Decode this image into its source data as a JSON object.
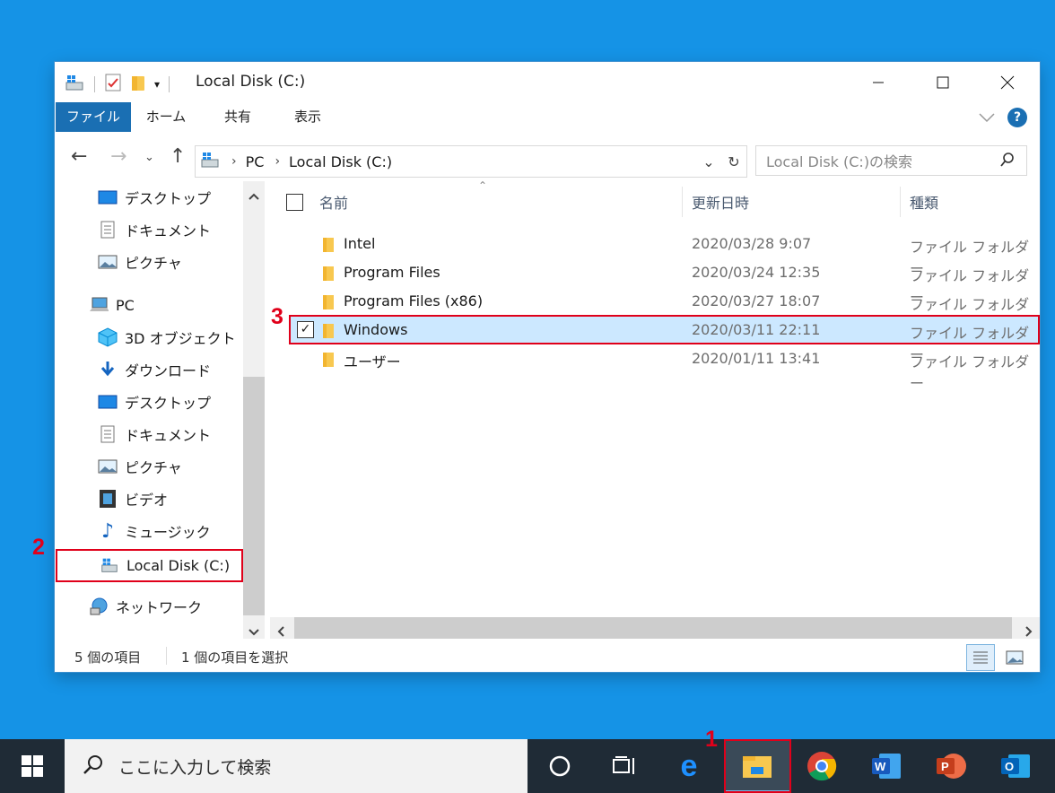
{
  "window": {
    "title": "Local Disk (C:)",
    "tabs": [
      "ファイル",
      "ホーム",
      "共有",
      "表示"
    ],
    "help": "?"
  },
  "nav": {
    "breadcrumb": [
      "PC",
      "Local Disk (C:)"
    ],
    "search_placeholder": "Local Disk (C:)の検索"
  },
  "sidebar": {
    "items": [
      {
        "label": "デスクトップ",
        "icon": "desktop-icon"
      },
      {
        "label": "ドキュメント",
        "icon": "document-icon"
      },
      {
        "label": "ピクチャ",
        "icon": "picture-icon"
      },
      {
        "label": "PC",
        "icon": "pc-icon"
      },
      {
        "label": "3D オブジェクト",
        "icon": "3d-objects-icon"
      },
      {
        "label": "ダウンロード",
        "icon": "download-icon"
      },
      {
        "label": "デスクトップ",
        "icon": "desktop-icon"
      },
      {
        "label": "ドキュメント",
        "icon": "document-icon"
      },
      {
        "label": "ピクチャ",
        "icon": "picture-icon"
      },
      {
        "label": "ビデオ",
        "icon": "video-icon"
      },
      {
        "label": "ミュージック",
        "icon": "music-icon"
      },
      {
        "label": "Local Disk (C:)",
        "icon": "local-disk-icon"
      },
      {
        "label": "ネットワーク",
        "icon": "network-icon"
      }
    ]
  },
  "columns": {
    "name": "名前",
    "date": "更新日時",
    "type": "種類"
  },
  "files": [
    {
      "name": "Intel",
      "date": "2020/03/28 9:07",
      "type": "ファイル フォルダー"
    },
    {
      "name": "Program Files",
      "date": "2020/03/24 12:35",
      "type": "ファイル フォルダー"
    },
    {
      "name": "Program Files (x86)",
      "date": "2020/03/27 18:07",
      "type": "ファイル フォルダー"
    },
    {
      "name": "Windows",
      "date": "2020/03/11 22:11",
      "type": "ファイル フォルダー"
    },
    {
      "name": "ユーザー",
      "date": "2020/01/11 13:41",
      "type": "ファイル フォルダー"
    }
  ],
  "status": {
    "count": "5 個の項目",
    "selected": "1 個の項目を選択"
  },
  "taskbar": {
    "search_placeholder": "ここに入力して検索"
  },
  "steps": [
    "1",
    "2",
    "3"
  ],
  "colors": {
    "accent": "#1a6fb3",
    "highlight": "#e0001a",
    "selection": "#cce8ff",
    "desktop": "#1593e6"
  }
}
